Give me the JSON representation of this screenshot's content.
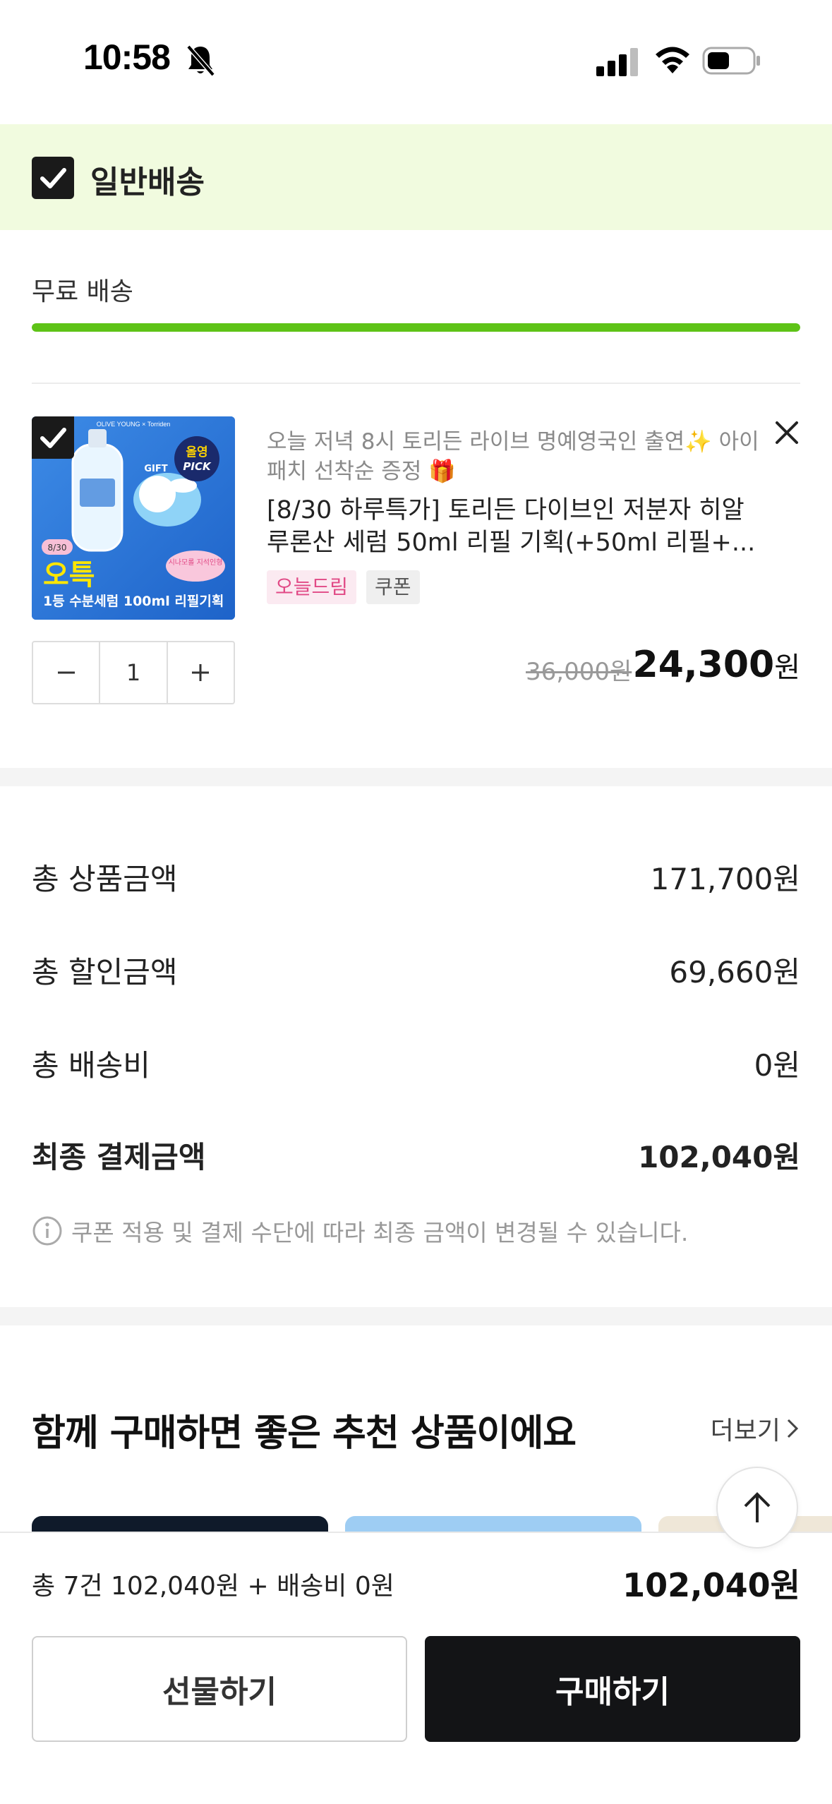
{
  "status_bar": {
    "time": "10:58",
    "icons": [
      "bell-slash-icon",
      "signal-icon",
      "wifi-icon",
      "battery-icon"
    ]
  },
  "shipping_group": {
    "checked": true,
    "title": "일반배송",
    "free_shipping_label": "무료 배송",
    "free_shipping_progress": 1.0
  },
  "product": {
    "checked": true,
    "thumbnail_texts": {
      "brand": "OLIVE YOUNG × Torriden",
      "date": "8/30",
      "headline": "오특",
      "sub": "1등 수분세럼 100ml 리필기획",
      "pick_line1": "올영",
      "pick_line2": "PICK",
      "gift": "GIFT",
      "tag": "시나모롤 지석인형"
    },
    "promo_text": "오늘 저녁 8시 토리든 라이브 명예영국인 출연✨ 아이패치 선착순 증정 🎁",
    "name": "[8/30 하루특가] 토리든 다이브인 저분자 히알루론산 세럼 50ml 리필 기획(+50ml 리필+...",
    "badges": [
      "오늘드림",
      "쿠폰"
    ],
    "quantity": "1",
    "original_price": "36,000원",
    "sale_price": "24,300",
    "sale_price_unit": "원"
  },
  "summary": {
    "rows": [
      {
        "label": "총 상품금액",
        "value": "171,700원"
      },
      {
        "label": "총 할인금액",
        "value": "69,660원"
      },
      {
        "label": "총 배송비",
        "value": "0원"
      }
    ],
    "final": {
      "label": "최종 결제금액",
      "value": "102,040원"
    },
    "notice": "쿠폰 적용 및 결제 수단에 따라 최종 금액이 변경될 수 있습니다."
  },
  "recommendations": {
    "title": "함께 구매하면 좋은 추천 상품이에요",
    "more_label": "더보기"
  },
  "bottom_bar": {
    "summary": "총 7건 102,040원 + 배송비 0원",
    "total": "102,040원",
    "gift_button": "선물하기",
    "buy_button": "구매하기"
  },
  "colors": {
    "accent_green": "#5ec317",
    "header_bg": "#f1fbdf",
    "badge_pink": "#e14a86",
    "buy_button_bg": "#131416"
  }
}
